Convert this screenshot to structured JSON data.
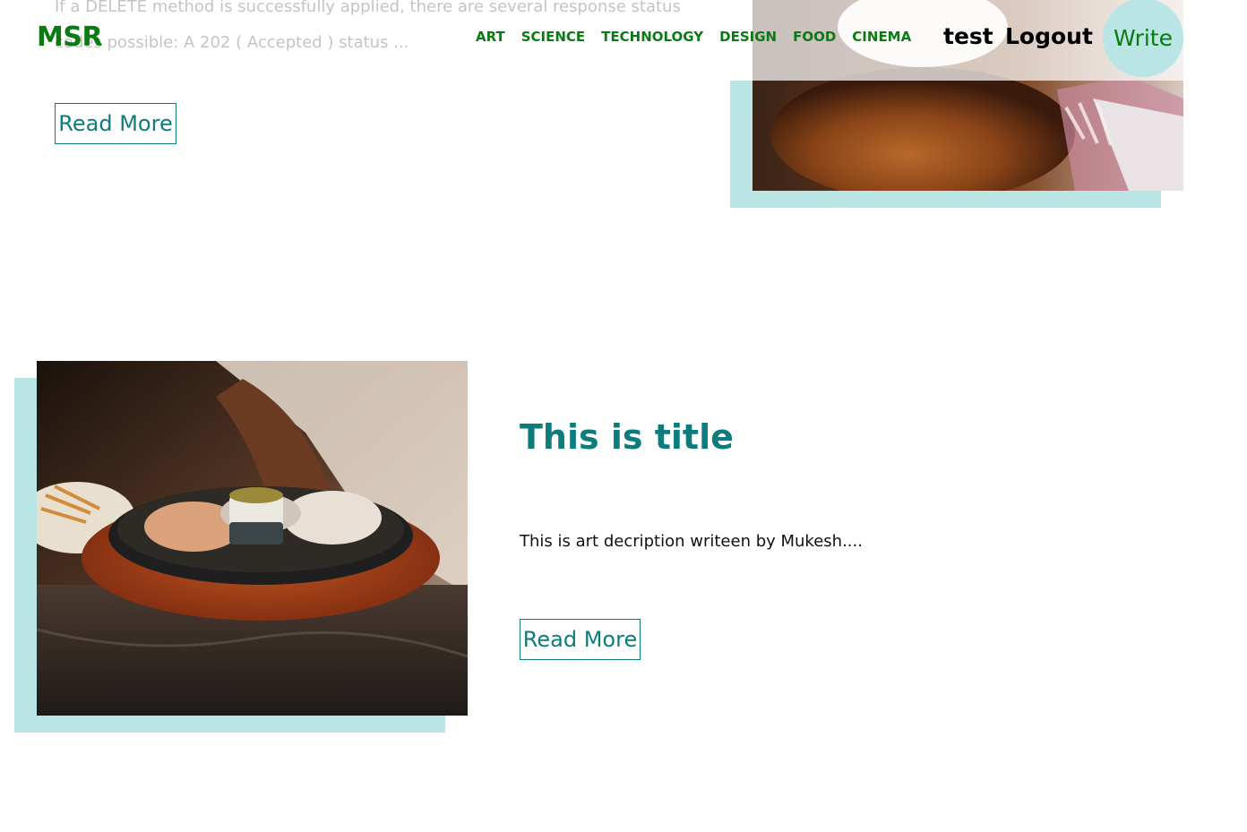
{
  "header": {
    "logo": "MSR",
    "nav": [
      "ART",
      "SCIENCE",
      "TECHNOLOGY",
      "DESIGN",
      "FOOD",
      "CINEMA"
    ],
    "user": "test",
    "logout": "Logout",
    "write": "Write"
  },
  "posts": [
    {
      "description": "If a DELETE method is successfully applied, there are several response status codes possible: A 202 ( Accepted ) status ...",
      "read_more": "Read More",
      "image": "cupcake-photo"
    },
    {
      "title": "This is title",
      "description": "This is art decription writeen by Mukesh....",
      "read_more": "Read More",
      "image": "tandoori-platter-photo"
    }
  ],
  "colors": {
    "brand_green": "#0a7a12",
    "teal_text": "#0d7c7c",
    "accent_mint": "#b9e6e5"
  }
}
